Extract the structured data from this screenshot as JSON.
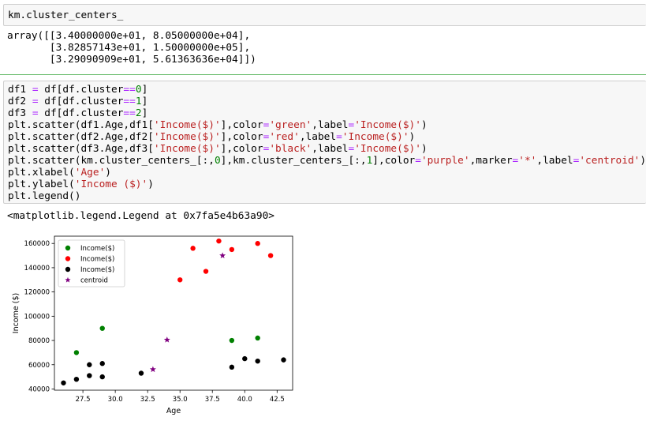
{
  "cell1": {
    "code": "km.cluster_centers_",
    "output": [
      "array([[3.40000000e+01, 8.05000000e+04],",
      "       [3.82857143e+01, 1.50000000e+05],",
      "       [3.29090909e+01, 5.61363636e+04]])"
    ]
  },
  "cell2": {
    "lines": [
      [
        [
          "df1 ",
          "kw"
        ],
        [
          "=",
          "op"
        ],
        [
          " df[df.cluster",
          "kw"
        ],
        [
          "==",
          "op"
        ],
        [
          "0",
          "num"
        ],
        [
          "]",
          "kw"
        ]
      ],
      [
        [
          "df2 ",
          "kw"
        ],
        [
          "=",
          "op"
        ],
        [
          " df[df.cluster",
          "kw"
        ],
        [
          "==",
          "op"
        ],
        [
          "1",
          "num"
        ],
        [
          "]",
          "kw"
        ]
      ],
      [
        [
          "df3 ",
          "kw"
        ],
        [
          "=",
          "op"
        ],
        [
          " df[df.cluster",
          "kw"
        ],
        [
          "==",
          "op"
        ],
        [
          "2",
          "num"
        ],
        [
          "]",
          "kw"
        ]
      ],
      [
        [
          "plt.scatter(df1.Age,df1[",
          "kw"
        ],
        [
          "'Income($)'",
          "str"
        ],
        [
          "],color",
          "kw"
        ],
        [
          "=",
          "op"
        ],
        [
          "'green'",
          "str"
        ],
        [
          ",label",
          "kw"
        ],
        [
          "=",
          "op"
        ],
        [
          "'Income($)'",
          "str"
        ],
        [
          ")",
          "kw"
        ]
      ],
      [
        [
          "plt.scatter(df2.Age,df2[",
          "kw"
        ],
        [
          "'Income($)'",
          "str"
        ],
        [
          "],color",
          "kw"
        ],
        [
          "=",
          "op"
        ],
        [
          "'red'",
          "str"
        ],
        [
          ",label",
          "kw"
        ],
        [
          "=",
          "op"
        ],
        [
          "'Income($)'",
          "str"
        ],
        [
          ")",
          "kw"
        ]
      ],
      [
        [
          "plt.scatter(df3.Age,df3[",
          "kw"
        ],
        [
          "'Income($)'",
          "str"
        ],
        [
          "],color",
          "kw"
        ],
        [
          "=",
          "op"
        ],
        [
          "'black'",
          "str"
        ],
        [
          ",label",
          "kw"
        ],
        [
          "=",
          "op"
        ],
        [
          "'Income($)'",
          "str"
        ],
        [
          ")",
          "kw"
        ]
      ],
      [
        [
          "plt.scatter(km.cluster_centers_[:,",
          "kw"
        ],
        [
          "0",
          "num"
        ],
        [
          "],km.cluster_centers_[:,",
          "kw"
        ],
        [
          "1",
          "num"
        ],
        [
          "],color",
          "kw"
        ],
        [
          "=",
          "op"
        ],
        [
          "'purple'",
          "str"
        ],
        [
          ",marker",
          "kw"
        ],
        [
          "=",
          "op"
        ],
        [
          "'*'",
          "str"
        ],
        [
          ",label",
          "kw"
        ],
        [
          "=",
          "op"
        ],
        [
          "'centroid'",
          "str"
        ],
        [
          ")",
          "kw"
        ]
      ],
      [
        [
          "plt.xlabel(",
          "kw"
        ],
        [
          "'Age'",
          "str"
        ],
        [
          ")",
          "kw"
        ]
      ],
      [
        [
          "plt.ylabel(",
          "kw"
        ],
        [
          "'Income ($)'",
          "str"
        ],
        [
          ")",
          "kw"
        ]
      ],
      [
        [
          "plt.legend()",
          "kw"
        ]
      ]
    ],
    "output": "<matplotlib.legend.Legend at 0x7fa5e4b63a90>"
  },
  "chart_data": {
    "type": "scatter",
    "xlabel": "Age",
    "ylabel": "Income ($)",
    "xlim": [
      25.3,
      43.7
    ],
    "ylim": [
      39000,
      166000
    ],
    "xticks": [
      "27.5",
      "30.0",
      "32.5",
      "35.0",
      "37.5",
      "40.0",
      "42.5"
    ],
    "yticks": [
      "40000",
      "60000",
      "80000",
      "100000",
      "120000",
      "140000",
      "160000"
    ],
    "legend_position": "top-left",
    "series": [
      {
        "name": "Income($)",
        "color": "#008000",
        "marker": "circle",
        "points": [
          [
            27,
            70000
          ],
          [
            29,
            90000
          ],
          [
            39,
            80000
          ],
          [
            41,
            82000
          ]
        ]
      },
      {
        "name": "Income($)",
        "color": "#ff0000",
        "marker": "circle",
        "points": [
          [
            35,
            130000
          ],
          [
            36,
            156000
          ],
          [
            37,
            137000
          ],
          [
            38,
            162000
          ],
          [
            39,
            155000
          ],
          [
            41,
            160000
          ],
          [
            42,
            150000
          ]
        ]
      },
      {
        "name": "Income($)",
        "color": "#000000",
        "marker": "circle",
        "points": [
          [
            26,
            45000
          ],
          [
            27,
            48000
          ],
          [
            28,
            51000
          ],
          [
            28,
            60000
          ],
          [
            29,
            50000
          ],
          [
            29,
            61000
          ],
          [
            32,
            53000
          ],
          [
            39,
            58000
          ],
          [
            40,
            65000
          ],
          [
            41,
            63000
          ],
          [
            43,
            64000
          ]
        ]
      },
      {
        "name": "centroid",
        "color": "#800080",
        "marker": "star",
        "points": [
          [
            34.0,
            80500
          ],
          [
            38.2857143,
            150000
          ],
          [
            32.9090909,
            56136.3636
          ]
        ]
      }
    ]
  }
}
